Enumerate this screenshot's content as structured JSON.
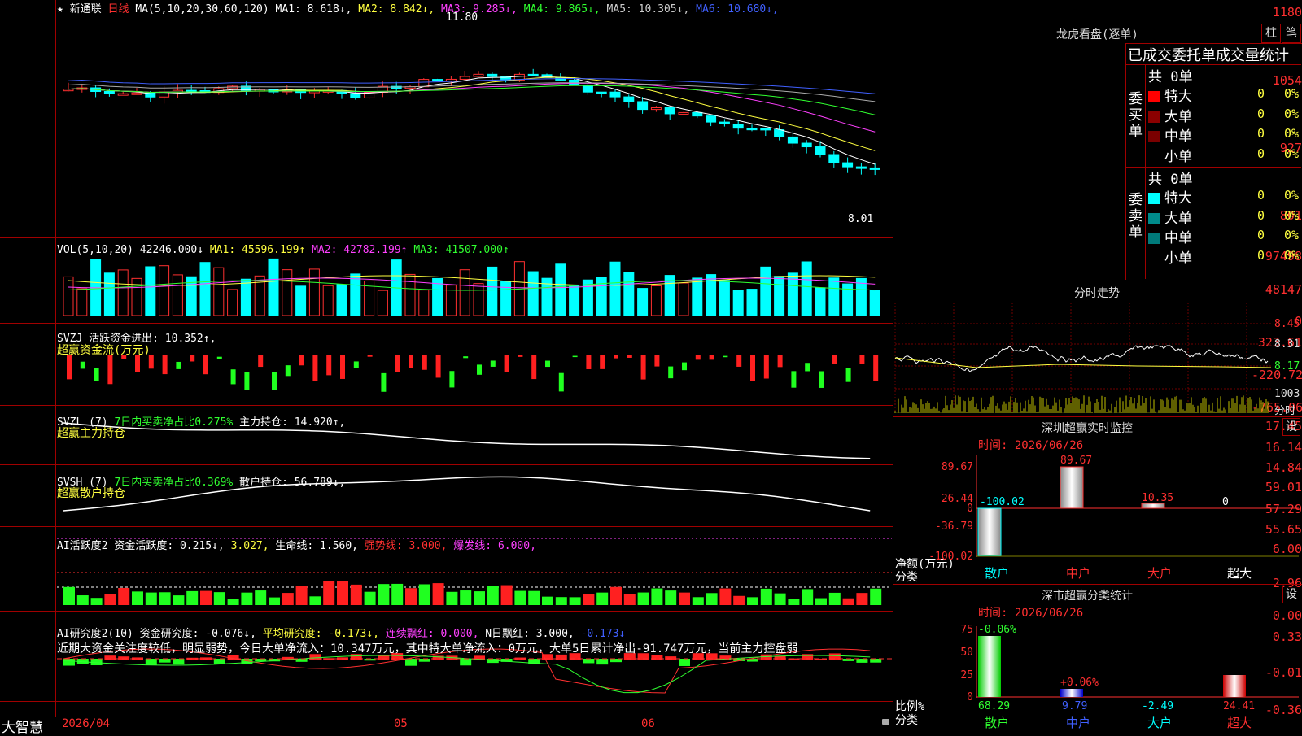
{
  "stock": {
    "star": "★",
    "name": "新通联",
    "period": "日线"
  },
  "kline": {
    "ma_label": "MA(5,10,20,30,60,120)",
    "ma": [
      {
        "t": "MA1: 8.618↓",
        "c": "#ffffff"
      },
      {
        "t": "MA2: 8.842↓",
        "c": "#ffff40"
      },
      {
        "t": "MA3: 9.285↓",
        "c": "#ff40ff"
      },
      {
        "t": "MA4: 9.865↓",
        "c": "#30ff30"
      },
      {
        "t": "MA5: 10.305↓",
        "c": "#cccccc"
      },
      {
        "t": "MA6: 10.680↓",
        "c": "#4060ff"
      }
    ],
    "yticks": [
      "1180",
      "1054",
      "927",
      "801"
    ],
    "high_label": "11.80",
    "low_label": "8.01"
  },
  "vol": {
    "label": "VOL(5,10,20)",
    "v": "42246.000↓",
    "ma1": "MA1: 45596.199↑",
    "ma2": "MA2: 42782.199↑",
    "ma3": "MA3: 41507.000↑",
    "yticks": [
      "97498",
      "48147",
      "0"
    ]
  },
  "svzj": {
    "label": "SVZJ",
    "a": "活跃资金进出: 10.352↑,",
    "b": "超赢资金流(万元)",
    "yticks": [
      "323.61",
      "-220.72",
      "-765.06"
    ]
  },
  "svzl": {
    "label": "SVZL (7)",
    "a": "7日内买卖净占比0.275%",
    "b": "主力持仓: 14.920↑,",
    "c": "超赢主力持仓",
    "yticks": [
      "17.45",
      "16.14",
      "14.84"
    ]
  },
  "svsh": {
    "label": "SVSH (7)",
    "a": "7日内买卖净占比0.369%",
    "b": "散户持仓: 56.789↓,",
    "c": "超赢散户持仓",
    "yticks": [
      "59.01",
      "57.29",
      "55.65"
    ]
  },
  "ai1": {
    "label": "AI活跃度2",
    "a": "资金活跃度: 0.215↓,",
    "b": "3.027,",
    "c": "生命线: 1.560,",
    "d": "强势线: 3.000,",
    "e": "爆发线: 6.000,",
    "yticks": [
      "6.00",
      "2.96",
      "0.00"
    ]
  },
  "ai2": {
    "label": "AI研究度2(10)",
    "a": "资金研究度: -0.076↓,",
    "b": "平均研究度: -0.173↓,",
    "c": "连续飘红: 0.000,",
    "d": "N日飘红: 3.000,",
    "e": "-0.173↓",
    "comment": "近期大资金关注度较低，明显弱势，今日大单净流入：10.347万元，其中特大单净流入：0万元，大单5日累计净出-91.747万元，当前主力控盘弱",
    "yticks": [
      "0.33",
      "-0.01",
      "-0.36"
    ]
  },
  "bottom": {
    "brand": "大智慧",
    "date": "2026/04",
    "m1": "05",
    "m2": "06"
  },
  "right": {
    "lhb_title": "龙虎看盘(逐单)",
    "btn1": "柱",
    "btn2": "笔",
    "stat_title": "已成交委托单成交量统计",
    "buy_label": "委买单",
    "sell_label": "委卖单",
    "total": "共 0单",
    "rows": [
      {
        "n": "特大",
        "v": "0",
        "p": "0%"
      },
      {
        "n": "大单",
        "v": "0",
        "p": "0%"
      },
      {
        "n": "中单",
        "v": "0",
        "p": "0%"
      },
      {
        "n": "小单",
        "v": "0",
        "p": "0%"
      }
    ],
    "buy_colors": [
      "#ff0000",
      "#8b0000",
      "#7a0000",
      ""
    ],
    "sell_colors": [
      "#00ffff",
      "#008b8b",
      "#007a7a",
      ""
    ],
    "fs_title": "分时走势",
    "fs_y": [
      "8.45",
      "8.31",
      "8.17"
    ],
    "fs_vol": "1003",
    "fs_vol_label": "分时",
    "sz_title": "深圳超赢实时监控",
    "sz_btn": "设",
    "time": "时间: 2026/06/26",
    "sz_y": [
      "89.67",
      "26.44",
      "0",
      "-36.79",
      "-100.02"
    ],
    "sz_vals": [
      "-100.02",
      "89.67",
      "10.35",
      "0"
    ],
    "net_label": "净额(万元)",
    "cat_label": "分类",
    "cats": [
      "散户",
      "中户",
      "大户",
      "超大"
    ],
    "sc_title": "深市超赢分类统计",
    "sc_btn": "设",
    "sc_y": [
      "75",
      "50",
      "25",
      "0"
    ],
    "sc_top": [
      "-0.06%",
      "+0.06%"
    ],
    "sc_vals": [
      "68.29",
      "9.79",
      "-2.49",
      "24.41"
    ],
    "ratio_label": "比例%",
    "cat2_label": "分类"
  }
}
